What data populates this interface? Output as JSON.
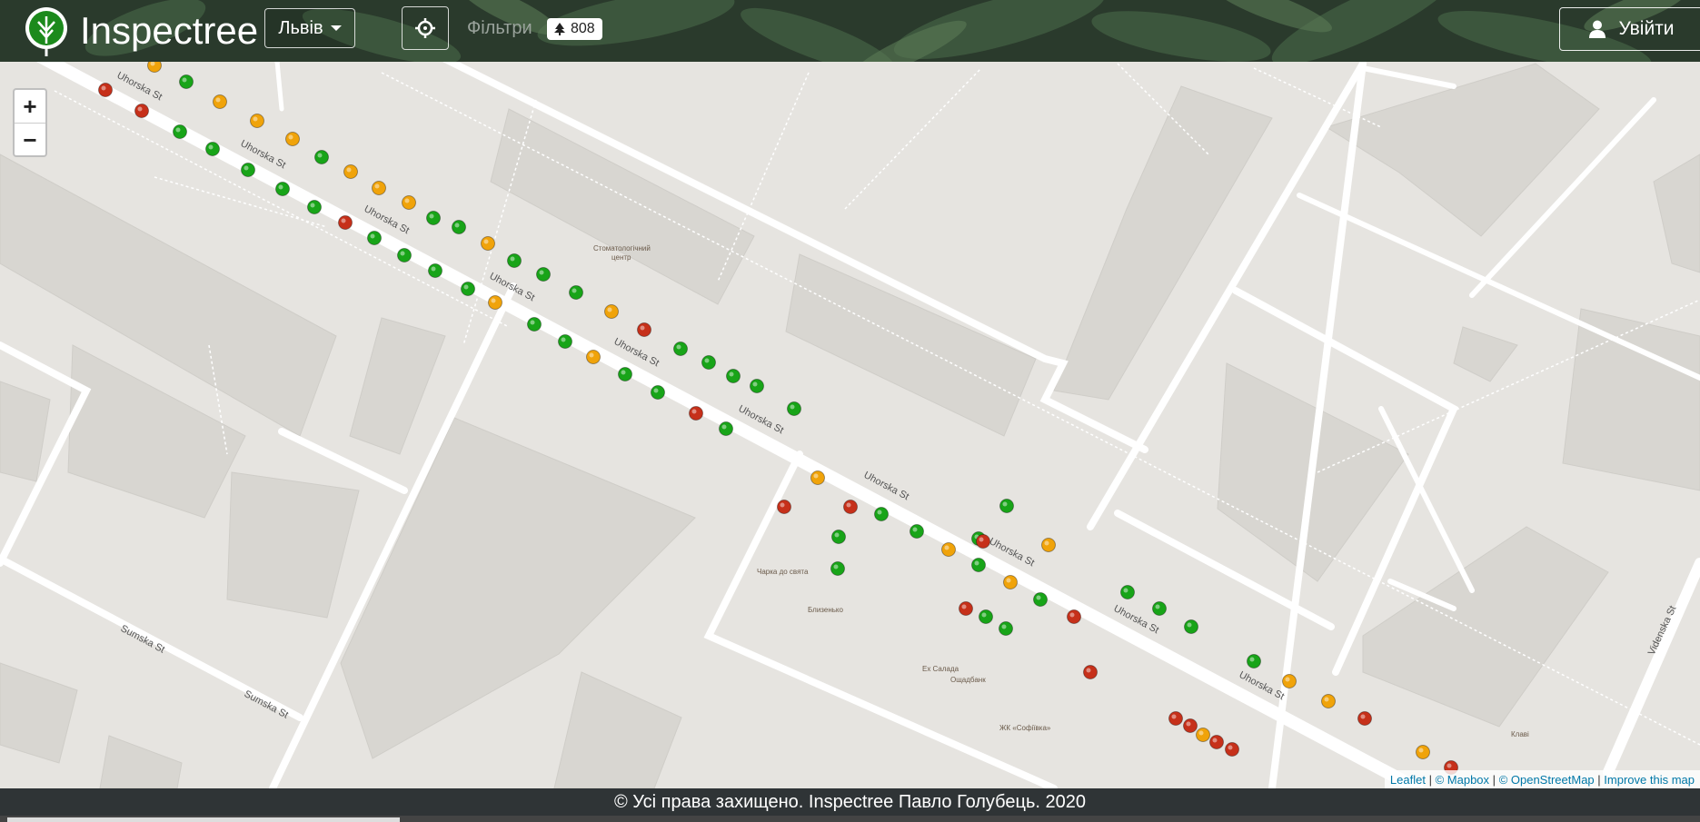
{
  "header": {
    "brand": "Inspectree",
    "city_label": "Львів",
    "filters_label": "Фільтри",
    "tree_count": "808",
    "login_label": "Увійти"
  },
  "map": {
    "zoom_in": "+",
    "zoom_out": "−",
    "street_labels": [
      "Uhorska St",
      "Uhorska St",
      "Uhorska St",
      "Uhorska St",
      "Uhorska St",
      "Uhorska St",
      "Uhorska St",
      "Uhorska St",
      "Uhorska St",
      "Uhorska St",
      "Sumska St",
      "Sumska St",
      "Videnska St"
    ],
    "poi_labels": [
      "Стоматологічний",
      "центр",
      "Чарка до свята",
      "Близенько",
      "Ех Салада",
      "Ощадбанк",
      "ЖК «Софіївка»",
      "Клаві"
    ],
    "marker_colors": {
      "healthy": "#18a418",
      "warning": "#f0a30a",
      "bad": "#c6301a"
    }
  },
  "attribution": {
    "leaflet": "Leaflet",
    "mapbox": "© Mapbox",
    "osm": "© OpenStreetMap",
    "improve": "Improve this map",
    "sep": "|"
  },
  "footer": {
    "text": "© Усі права захищено. Inspectree Павло Голубець. 2020"
  }
}
